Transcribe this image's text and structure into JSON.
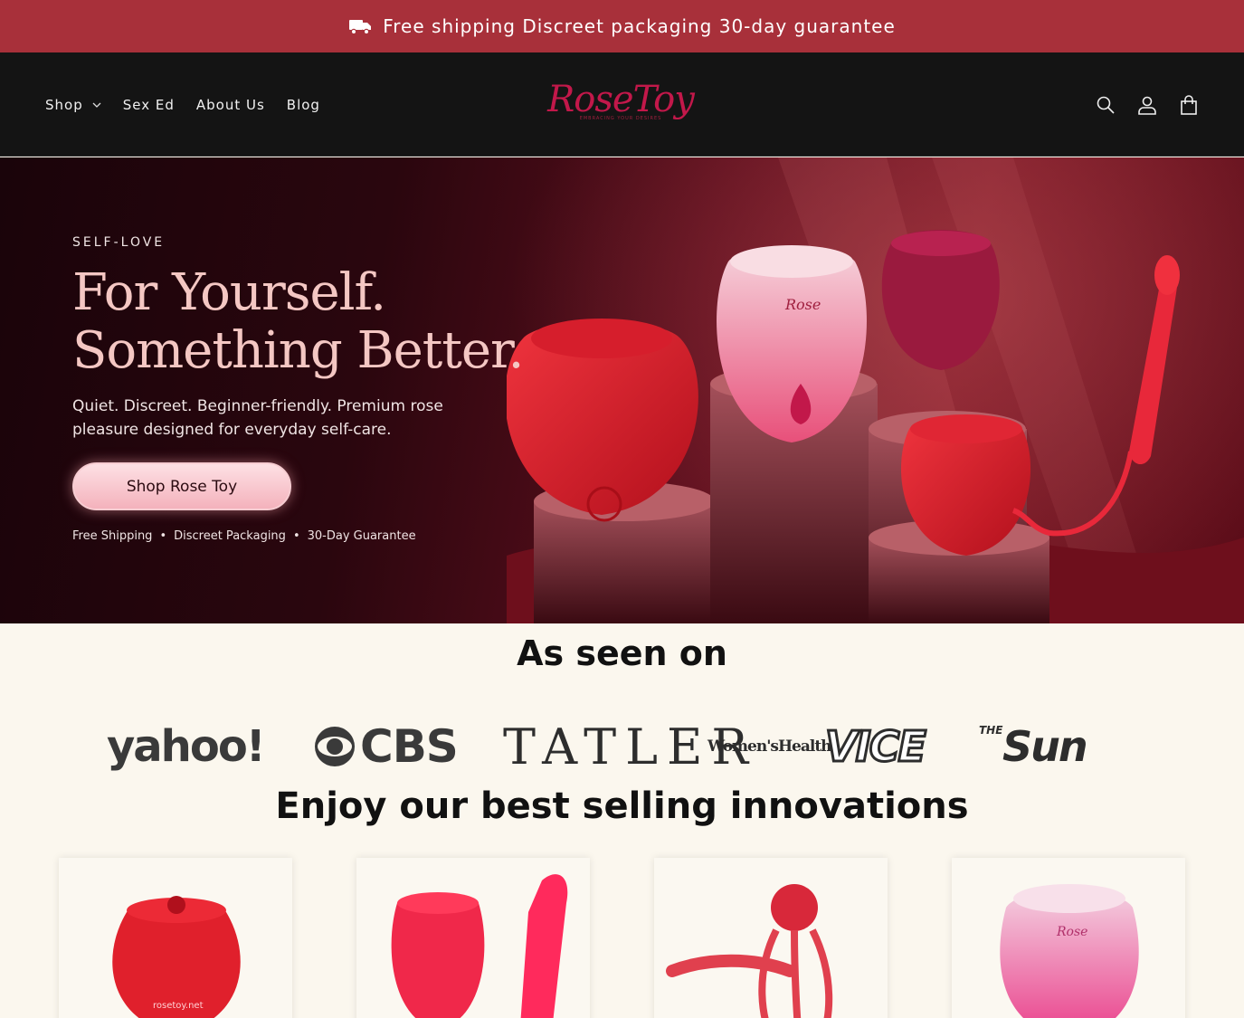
{
  "announcement": {
    "text": "Free shipping Discreet packaging 30-day guarantee",
    "icon": "truck-icon"
  },
  "header": {
    "nav": [
      {
        "label": "Shop",
        "has_dropdown": true
      },
      {
        "label": "Sex Ed"
      },
      {
        "label": "About Us"
      },
      {
        "label": "Blog"
      }
    ],
    "logo": {
      "word": "RoseToy",
      "tagline": "EMBRACING YOUR DESIRES"
    },
    "icons": [
      "search-icon",
      "account-icon",
      "cart-icon"
    ]
  },
  "hero": {
    "kicker": "SELF-LOVE",
    "title_line1": "For Yourself.",
    "title_line2": "Something Better.",
    "subtitle": "Quiet. Discreet. Beginner-friendly. Premium rose pleasure designed for everyday self-care.",
    "cta": "Shop Rose Toy",
    "badges": [
      "Free Shipping",
      "•",
      "Discreet Packaging",
      "•",
      "30-Day Guarantee"
    ]
  },
  "press": {
    "title": "As seen on",
    "logos": [
      "yahoo!",
      "CBS",
      "TATLER",
      "Women'sHealth",
      "VICE",
      "THE",
      "Sun"
    ]
  },
  "best_sellers": {
    "title": "Enjoy our best selling innovations",
    "products": [
      "rose-toy-red",
      "rose-toy-with-dildo",
      "rose-cock-ring",
      "rose-toy-pink"
    ]
  },
  "colors": {
    "announcement_bg": "#a8303a",
    "header_bg": "#141414",
    "logo": "#c2184a",
    "page_bg": "#fbf7ee",
    "hero_title": "#f4c7c3"
  }
}
